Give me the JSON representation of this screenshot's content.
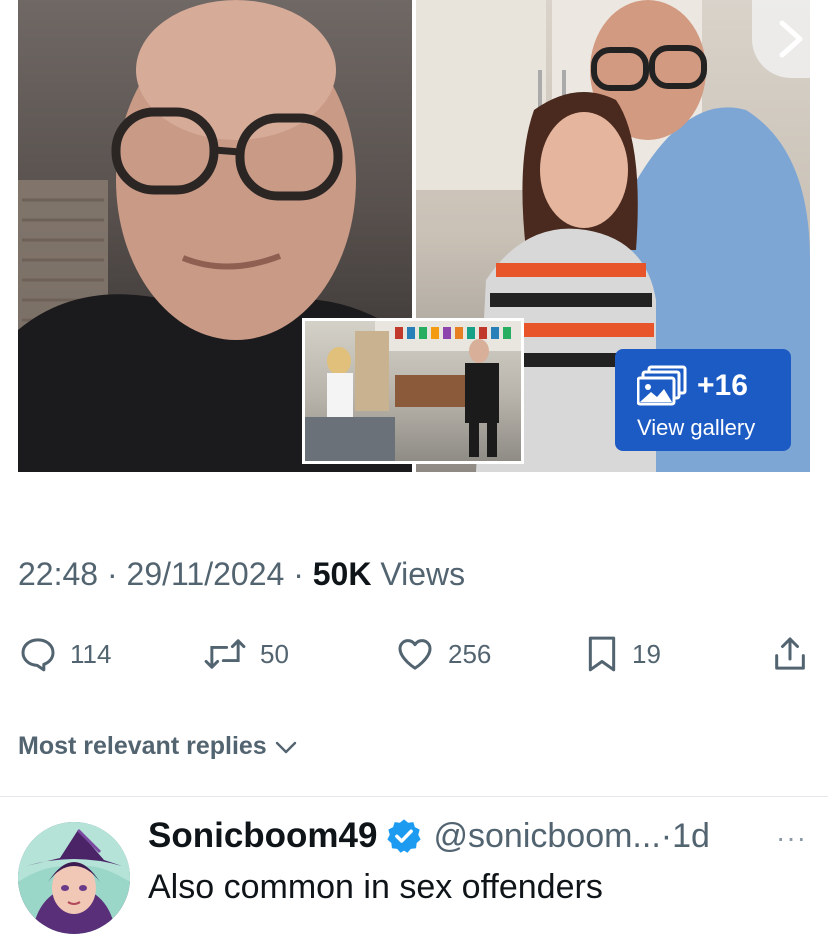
{
  "media": {
    "gallery_count": "+16",
    "gallery_label": "View gallery"
  },
  "tweet": {
    "time": "22:48",
    "date": "29/11/2024",
    "views_count": "50K",
    "views_label": "Views",
    "sep": "·"
  },
  "actions": {
    "replies": "114",
    "reposts": "50",
    "likes": "256",
    "bookmarks": "19"
  },
  "replies_filter": {
    "label": "Most relevant replies"
  },
  "reply": {
    "name": "Sonicboom49",
    "handle": "@sonicboom...",
    "sep": "·",
    "time": "1d",
    "text": "Also common in sex offenders",
    "more": "···"
  },
  "colors": {
    "verified": "#1d9bf0",
    "gallery_button": "#1d5bc4",
    "muted_text": "#536471"
  }
}
